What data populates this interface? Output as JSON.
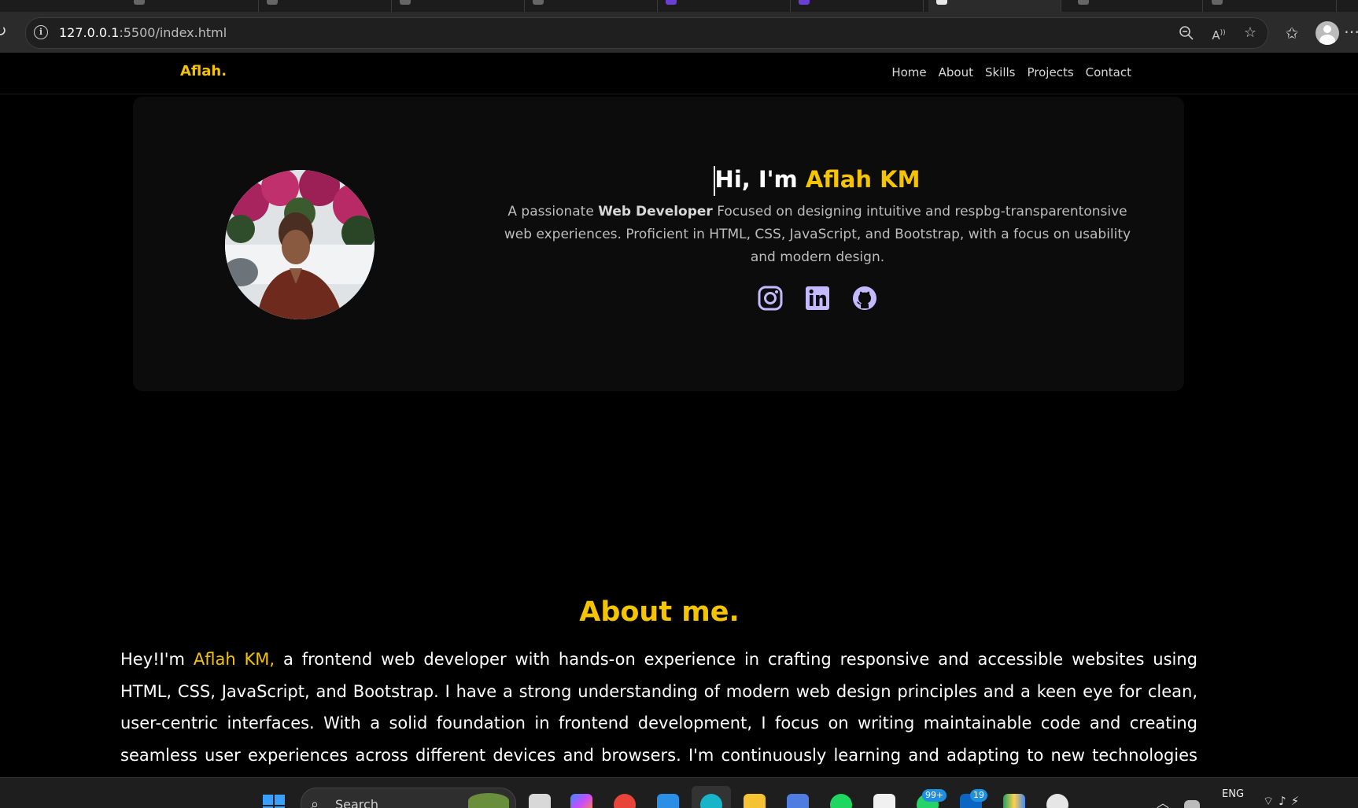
{
  "browser": {
    "url_host": "127.0.0.1",
    "url_rest": ":5500/index.html"
  },
  "site": {
    "brand": "Aflah.",
    "nav": [
      "Home",
      "About",
      "Skills",
      "Projects",
      "Contact"
    ],
    "hero": {
      "greeting": "Hi, I'm ",
      "name": "Aflah KM",
      "desc_pre": "A passionate ",
      "desc_bold": "Web Developer",
      "desc_post": " Focused on designing intuitive and respbg-transparentonsive web experiences. Proficient in HTML, CSS, JavaScript, and Bootstrap, with a focus on usability and modern design."
    },
    "socials": [
      "instagram-icon",
      "linkedin-icon",
      "github-icon"
    ],
    "social_color": "#c4b8ff",
    "accent_color": "#f5c400",
    "about": {
      "title": "About me.",
      "intro": "Hey!I'm ",
      "name": "Aflah KM,",
      "body": " a frontend web developer with hands-on experience in crafting responsive and accessible websites using HTML, CSS, JavaScript, and Bootstrap. I have a strong understanding of modern web design principles and a keen eye for clean, user-centric interfaces. With a solid foundation in frontend development, I focus on writing maintainable code and creating seamless user experiences across different devices and browsers. I'm continuously learning and adapting to new technologies and frameworks to stay current in the"
    }
  },
  "taskbar": {
    "search_label": "Search",
    "badge_whatsapp": "99+",
    "badge_linkedin": "19",
    "language": "ENG"
  }
}
